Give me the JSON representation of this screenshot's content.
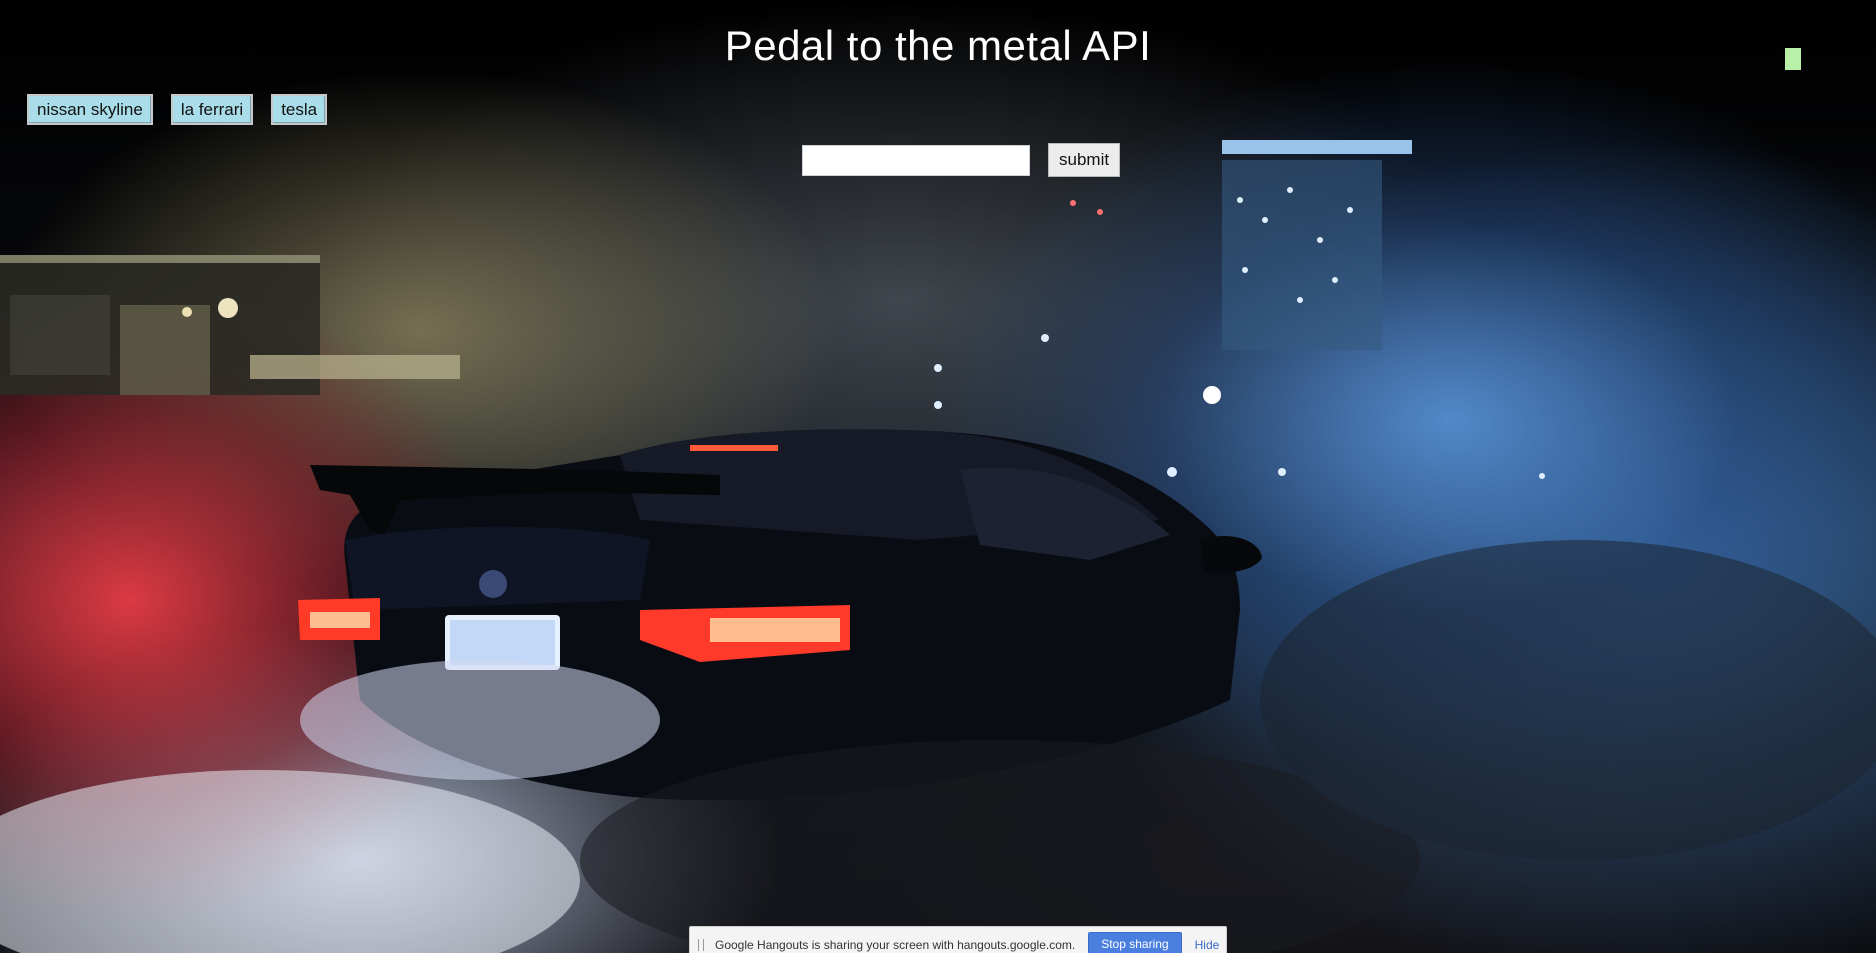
{
  "page": {
    "title": "Pedal to the metal API"
  },
  "car_buttons": [
    {
      "label": "nissan skyline"
    },
    {
      "label": "la ferrari"
    },
    {
      "label": "tesla"
    }
  ],
  "search": {
    "value": "",
    "placeholder": "",
    "submit_label": "submit"
  },
  "share_bar": {
    "message": "Google Hangouts is sharing your screen with hangouts.google.com.",
    "stop_label": "Stop sharing",
    "hide_label": "Hide"
  },
  "background": {
    "image_subject": "bmw-m3-burnout-smoke-photo"
  },
  "colors": {
    "car_button_bg": "#a9dde9",
    "stop_button_bg": "#4a7fe0",
    "title_text": "#ffffff"
  }
}
